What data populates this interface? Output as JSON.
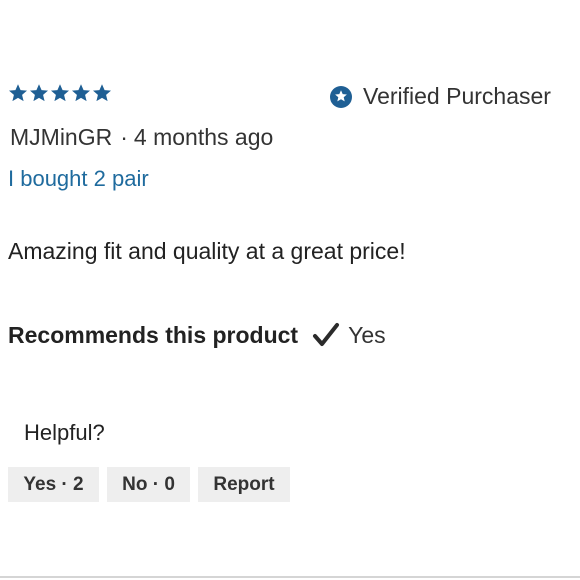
{
  "review": {
    "rating": 5,
    "rating_max": 5,
    "star_color": "#1f5f94",
    "verified_label": "Verified Purchaser",
    "reviewer_name": "MJMinGR",
    "separator": "·",
    "posted_ago": "4 months ago",
    "title": "I bought 2 pair",
    "title_color": "#1f6b9e",
    "body": "Amazing fit and quality at a great price!",
    "recommend_label": "Recommends this product",
    "recommend_value": "Yes"
  },
  "helpful": {
    "label": "Helpful?",
    "yes_label": "Yes · 2",
    "no_label": "No · 0",
    "report_label": "Report"
  },
  "icons": {
    "star": "star-icon",
    "verified": "verified-badge-icon",
    "check": "checkmark-icon"
  }
}
